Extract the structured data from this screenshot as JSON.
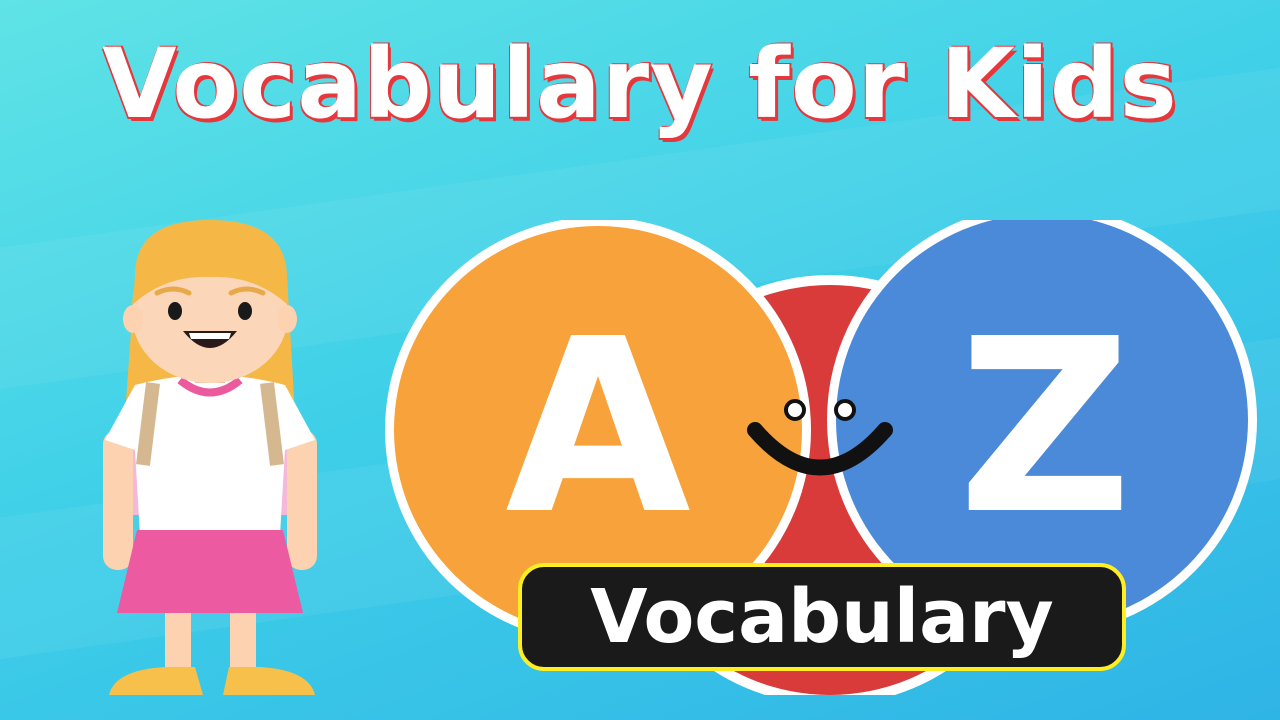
{
  "title": "Vocabulary for Kids",
  "logo": {
    "left_letter": "A",
    "right_letter": "Z",
    "left_color": "#f7a23a",
    "right_color": "#4a8ad8",
    "middle_color": "#d83b3a"
  },
  "badge": {
    "label": "Vocabulary",
    "border_color": "#ffee22"
  },
  "character": {
    "icon": "girl-with-backpack-illustration"
  }
}
